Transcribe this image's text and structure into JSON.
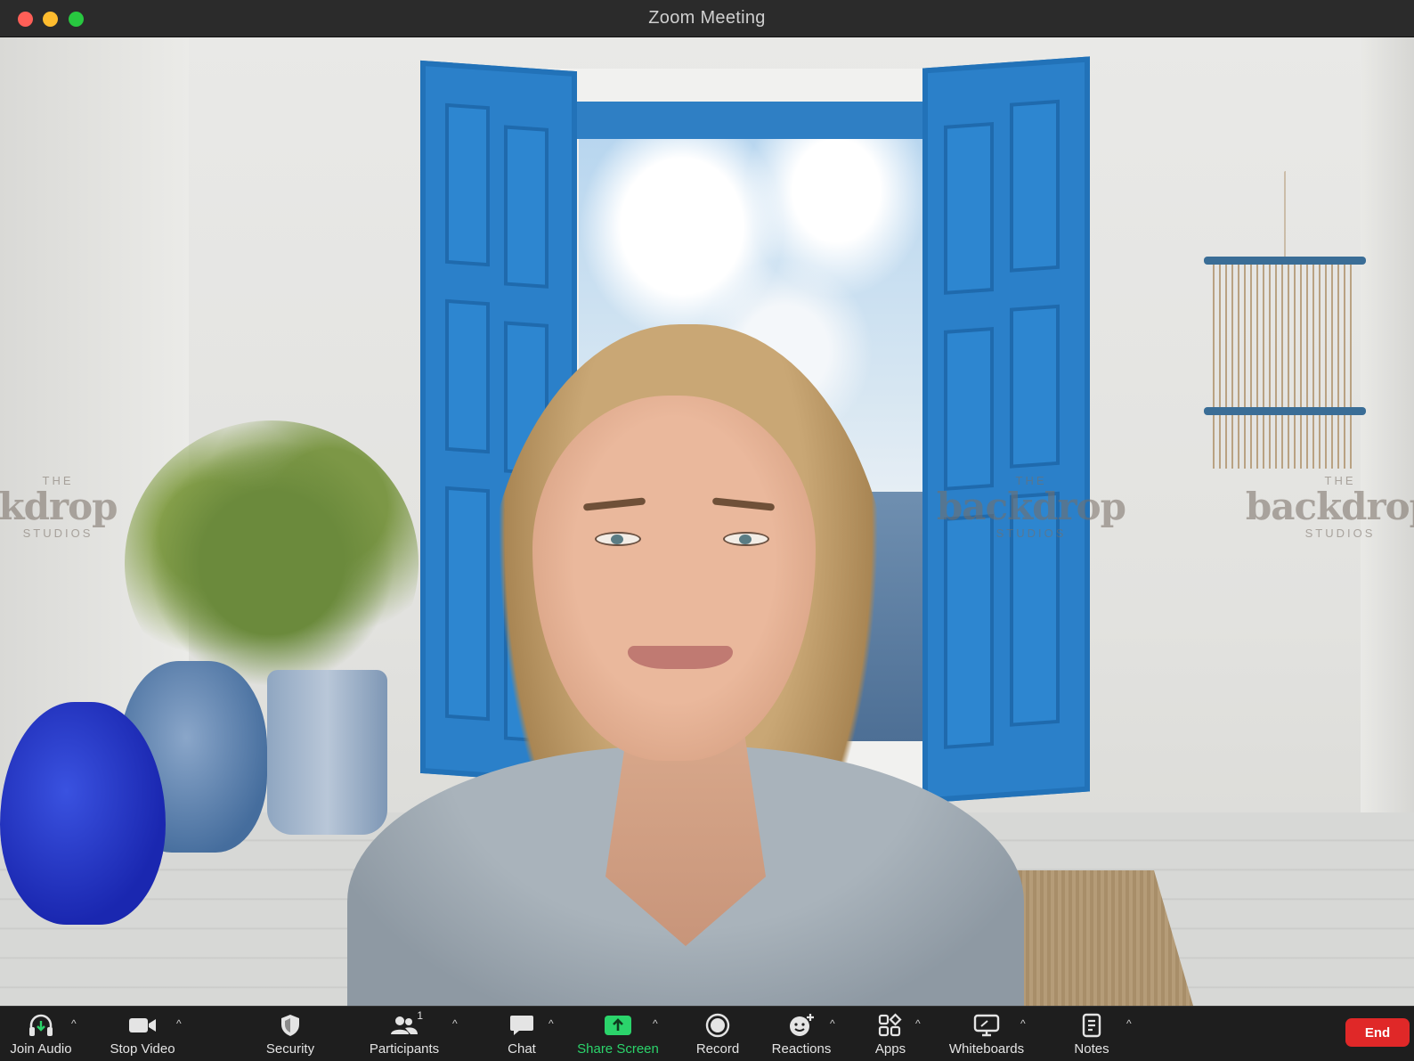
{
  "window": {
    "title": "Zoom Meeting"
  },
  "background": {
    "watermark_top": "THE",
    "watermark_brand": "backdrop",
    "watermark_brand_cropped": "kdrop",
    "watermark_bottom": "STUDIOS",
    "watermark_brand_right": "backdrop"
  },
  "toolbar": {
    "join_audio": "Join Audio",
    "stop_video": "Stop Video",
    "security": "Security",
    "participants": "Participants",
    "participants_count": "1",
    "chat": "Chat",
    "share_screen": "Share Screen",
    "record": "Record",
    "reactions": "Reactions",
    "apps": "Apps",
    "whiteboards": "Whiteboards",
    "notes": "Notes",
    "end": "End",
    "caret": "^"
  },
  "colors": {
    "share_accent": "#2bd46b",
    "end_button": "#e02828",
    "close": "#ff5f57",
    "minimize": "#febc2e",
    "zoom": "#28c840"
  }
}
